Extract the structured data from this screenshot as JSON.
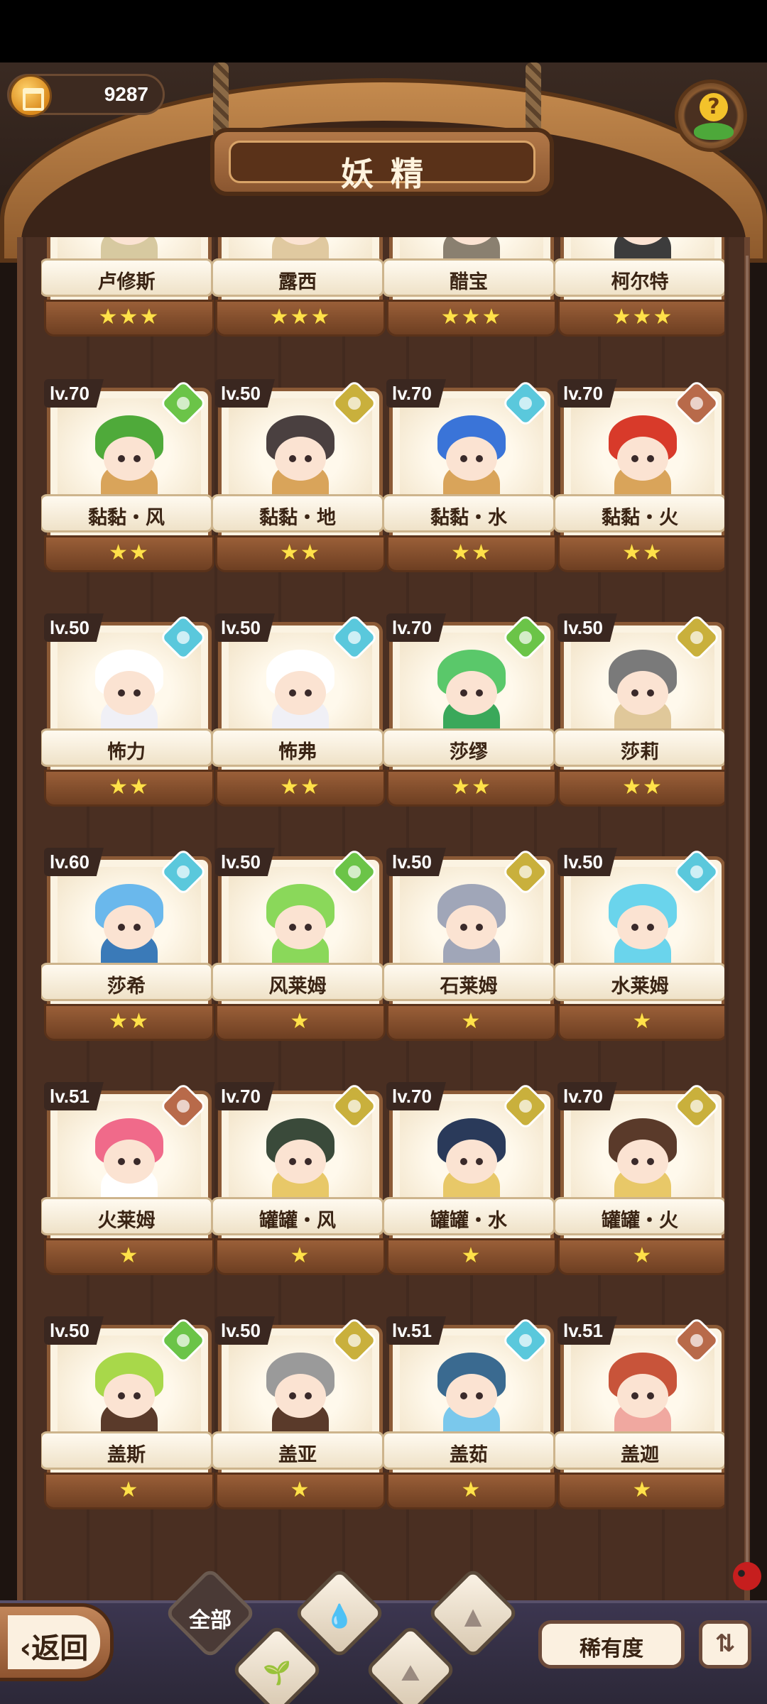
{
  "header": {
    "currency_value": "9287",
    "title": "妖精",
    "help_icon": "question-leaf-icon"
  },
  "elements": {
    "wind": "#6bc448",
    "earth": "#c9b03c",
    "water": "#5ac8dc",
    "fire": "#b86a4a"
  },
  "cards": [
    {
      "name": "卢修斯",
      "level": "",
      "stars": 3,
      "element": "",
      "hair": "#78cbe0",
      "body": "#d7c9a0"
    },
    {
      "name": "露西",
      "level": "",
      "stars": 3,
      "element": "",
      "hair": "#c8403a",
      "body": "#e0c9a0"
    },
    {
      "name": "醋宝",
      "level": "",
      "stars": 3,
      "element": "",
      "hair": "#2a2a2a",
      "body": "#8a8070"
    },
    {
      "name": "柯尔特",
      "level": "",
      "stars": 3,
      "element": "",
      "hair": "#3a3440",
      "body": "#3c3c3c"
    },
    {
      "name": "黏黏・风",
      "level": "lv.70",
      "stars": 2,
      "element": "wind",
      "hair": "#4faa3a",
      "body": "#d9a45a"
    },
    {
      "name": "黏黏・地",
      "level": "lv.50",
      "stars": 2,
      "element": "earth",
      "hair": "#4a4040",
      "body": "#d9a45a"
    },
    {
      "name": "黏黏・水",
      "level": "lv.70",
      "stars": 2,
      "element": "water",
      "hair": "#3a74d8",
      "body": "#d9a45a"
    },
    {
      "name": "黏黏・火",
      "level": "lv.70",
      "stars": 2,
      "element": "fire",
      "hair": "#d83a2a",
      "body": "#d9a45a"
    },
    {
      "name": "怖力",
      "level": "lv.50",
      "stars": 2,
      "element": "water",
      "hair": "#ffffff",
      "body": "#f0f0f6"
    },
    {
      "name": "怖弗",
      "level": "lv.50",
      "stars": 2,
      "element": "water",
      "hair": "#ffffff",
      "body": "#f0f0f6"
    },
    {
      "name": "莎缪",
      "level": "lv.70",
      "stars": 2,
      "element": "wind",
      "hair": "#5ac86a",
      "body": "#3aa85a"
    },
    {
      "name": "莎莉",
      "level": "lv.50",
      "stars": 2,
      "element": "earth",
      "hair": "#7a7a7a",
      "body": "#e0c89a"
    },
    {
      "name": "莎希",
      "level": "lv.60",
      "stars": 2,
      "element": "water",
      "hair": "#6ab8ec",
      "body": "#3a7ab8"
    },
    {
      "name": "风莱姆",
      "level": "lv.50",
      "stars": 1,
      "element": "wind",
      "hair": "#8ad85a",
      "body": "#8ad85a"
    },
    {
      "name": "石莱姆",
      "level": "lv.50",
      "stars": 1,
      "element": "earth",
      "hair": "#a0a6b8",
      "body": "#a0a6b8"
    },
    {
      "name": "水莱姆",
      "level": "lv.50",
      "stars": 1,
      "element": "water",
      "hair": "#6ad4ec",
      "body": "#6ad4ec"
    },
    {
      "name": "火莱姆",
      "level": "lv.51",
      "stars": 1,
      "element": "fire",
      "hair": "#f06a8a",
      "body": "#ffffff"
    },
    {
      "name": "罐罐・风",
      "level": "lv.70",
      "stars": 1,
      "element": "earth",
      "hair": "#3a4a3a",
      "body": "#e8c868"
    },
    {
      "name": "罐罐・水",
      "level": "lv.70",
      "stars": 1,
      "element": "earth",
      "hair": "#2a3a5a",
      "body": "#e8c868"
    },
    {
      "name": "罐罐・火",
      "level": "lv.70",
      "stars": 1,
      "element": "earth",
      "hair": "#5a3a2a",
      "body": "#e8c868"
    },
    {
      "name": "盖斯",
      "level": "lv.50",
      "stars": 1,
      "element": "wind",
      "hair": "#a8d84a",
      "body": "#5a3a2a"
    },
    {
      "name": "盖亚",
      "level": "lv.50",
      "stars": 1,
      "element": "earth",
      "hair": "#9a9a9a",
      "body": "#5a3a2a"
    },
    {
      "name": "盖茹",
      "level": "lv.51",
      "stars": 1,
      "element": "water",
      "hair": "#3a6a90",
      "body": "#7ac8ec"
    },
    {
      "name": "盖迦",
      "level": "lv.51",
      "stars": 1,
      "element": "fire",
      "hair": "#c8543a",
      "body": "#f0a8a0"
    }
  ],
  "bottom": {
    "back_label": "返回",
    "tab_all_label": "全部",
    "tabs_icons": [
      "water-drop-icon",
      "sprout-icon",
      "mountain-icon",
      "stone-icon",
      "volcano-icon"
    ],
    "rarity_label": "稀有度",
    "sort_icon": "sort-icon"
  }
}
